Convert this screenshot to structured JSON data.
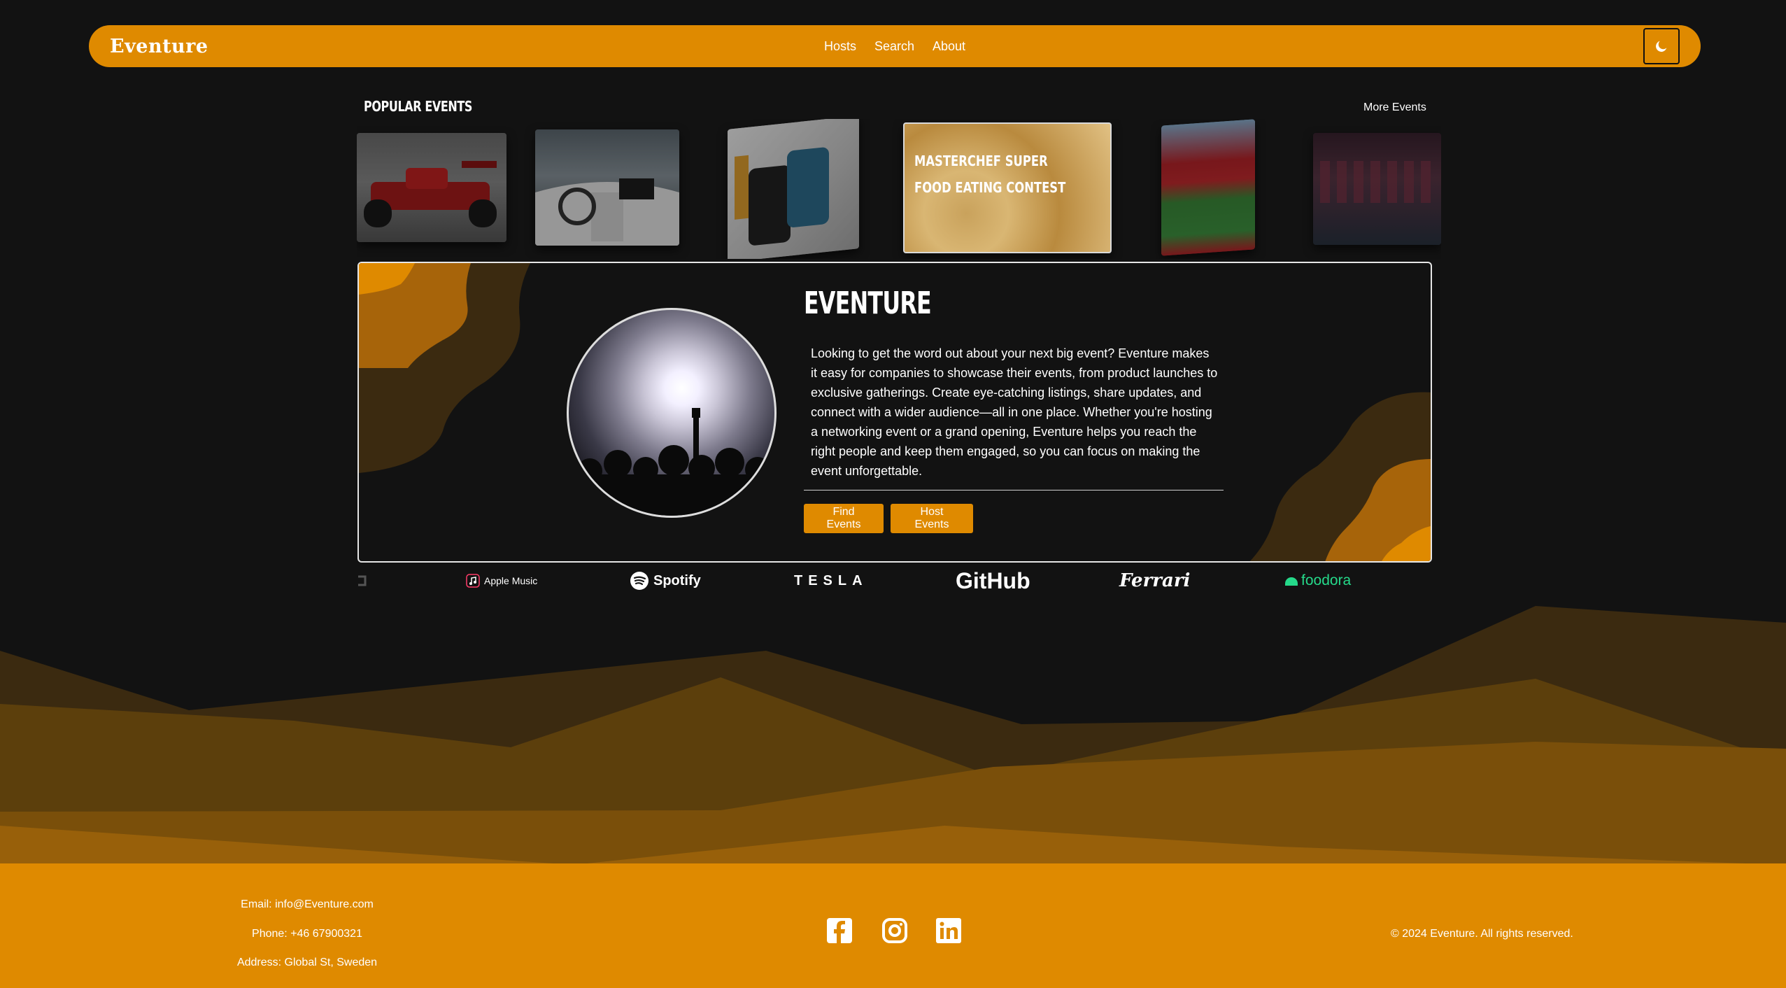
{
  "brand": "Eventure",
  "nav": {
    "links": [
      "Hosts",
      "Search",
      "About"
    ]
  },
  "theme_toggle_icon": "moon-icon",
  "popular": {
    "title": "Popular Events",
    "more_label": "More Events",
    "featured_title": "Masterchef Super Food Eating Contest"
  },
  "hero": {
    "title": "EVENTURE",
    "description": "Looking to get the word out about your next big event? Eventure makes it easy for companies to showcase their events, from product launches to exclusive gatherings. Create eye-catching listings, share updates, and connect with a wider audience—all in one place. Whether you're hosting a networking event or a grand opening, Eventure helps you reach the right people and keep them engaged, so you can focus on making the event unforgettable.",
    "find_label": "Find Events",
    "host_label": "Host Events"
  },
  "logos": {
    "apple_music": "Apple Music",
    "spotify": "Spotify",
    "tesla": "TESLA",
    "github": "GitHub",
    "ferrari": "Ferrari",
    "foodora": "foodora"
  },
  "footer": {
    "email": "Email: info@Eventure.com",
    "phone": "Phone: +46 67900321",
    "address": "Address: Global St, Sweden",
    "copyright": "© 2024 Eventure. All rights reserved.",
    "social_icons": [
      "facebook-icon",
      "instagram-icon",
      "linkedin-icon"
    ]
  },
  "colors": {
    "accent": "#df8a00",
    "background": "#121212",
    "dark_brown": "#3b2a10",
    "mid_brown": "#7a4f0a"
  }
}
